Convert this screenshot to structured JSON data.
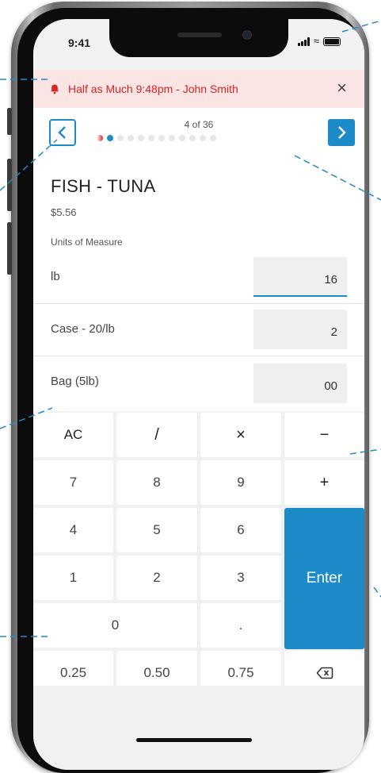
{
  "status_bar": {
    "time": "9:41"
  },
  "alert": {
    "text": "Half as Much 9:48pm - John Smith",
    "close_symbol": "×",
    "icon": "bell-icon"
  },
  "pager": {
    "counter": "4 of 36",
    "total_dots": 12,
    "active_dot": 1
  },
  "product": {
    "title": "FISH - TUNA",
    "price": "$5.56",
    "uom_label": "Units of Measure"
  },
  "uom_rows": [
    {
      "name": "lb",
      "value": "16"
    },
    {
      "name": "Case - 20/lb",
      "value": "2"
    },
    {
      "name": "Bag (5lb)",
      "value": "00"
    }
  ],
  "keypad": {
    "ac": "AC",
    "divide": "/",
    "multiply": "×",
    "minus": "−",
    "k7": "7",
    "k8": "8",
    "k9": "9",
    "plus": "+",
    "k4": "4",
    "k5": "5",
    "k6": "6",
    "enter": "Enter",
    "k1": "1",
    "k2": "2",
    "k3": "3",
    "k0": "0",
    "dot": ".",
    "q025": "0.25",
    "q050": "0.50",
    "q075": "0.75",
    "backspace_icon": "backspace-icon"
  },
  "colors": {
    "accent": "#1e8bc9",
    "alert_bg": "#fbe4e4",
    "alert_text": "#d4261f"
  }
}
